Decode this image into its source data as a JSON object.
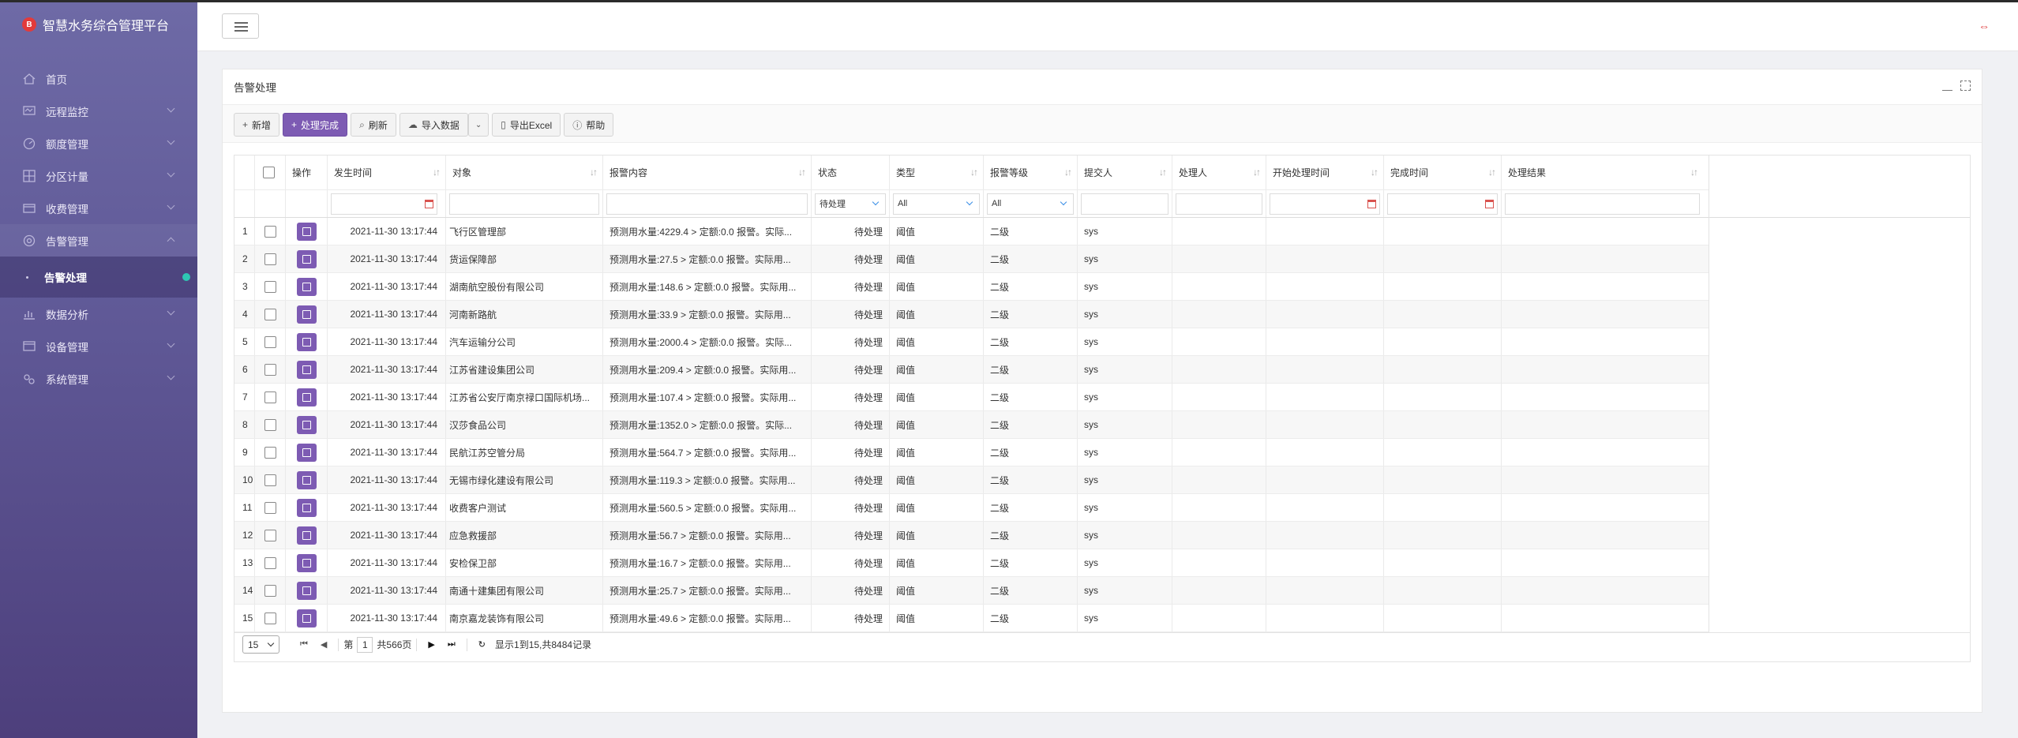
{
  "app": {
    "title": "智慧水务综合管理平台"
  },
  "sidebar": {
    "items": [
      {
        "label": "首页",
        "icon": "home-icon"
      },
      {
        "label": "远程监控",
        "icon": "monitor-icon"
      },
      {
        "label": "额度管理",
        "icon": "quota-icon"
      },
      {
        "label": "分区计量",
        "icon": "grid-icon"
      },
      {
        "label": "收费管理",
        "icon": "billing-icon"
      },
      {
        "label": "告警管理",
        "icon": "alarm-icon"
      },
      {
        "label": "数据分析",
        "icon": "analysis-icon"
      },
      {
        "label": "设备管理",
        "icon": "device-icon"
      },
      {
        "label": "系统管理",
        "icon": "settings-icon"
      }
    ],
    "sub_item": "告警处理"
  },
  "panel": {
    "title": "告警处理"
  },
  "toolbar": {
    "add": "新增",
    "complete": "处理完成",
    "refresh": "刷新",
    "import": "导入数据",
    "export": "导出Excel",
    "help": "帮助"
  },
  "table": {
    "columns": {
      "op": "操作",
      "time": "发生时间",
      "object": "对象",
      "content": "报警内容",
      "status": "状态",
      "type": "类型",
      "level": "报警等级",
      "submitter": "提交人",
      "handler": "处理人",
      "start": "开始处理时间",
      "end": "完成时间",
      "result": "处理结果"
    },
    "filters": {
      "status": "待处理",
      "type": "All",
      "level": "All"
    },
    "rows": [
      {
        "idx": "1",
        "time": "2021-11-30 13:17:44",
        "object": "飞行区管理部",
        "content": "预测用水量:4229.4 > 定额:0.0 报警。实际...",
        "status": "待处理",
        "type": "阈值",
        "level": "二级",
        "submitter": "sys"
      },
      {
        "idx": "2",
        "time": "2021-11-30 13:17:44",
        "object": "货运保障部",
        "content": "预测用水量:27.5 > 定额:0.0 报警。实际用...",
        "status": "待处理",
        "type": "阈值",
        "level": "二级",
        "submitter": "sys"
      },
      {
        "idx": "3",
        "time": "2021-11-30 13:17:44",
        "object": "湖南航空股份有限公司",
        "content": "预测用水量:148.6 > 定额:0.0 报警。实际用...",
        "status": "待处理",
        "type": "阈值",
        "level": "二级",
        "submitter": "sys"
      },
      {
        "idx": "4",
        "time": "2021-11-30 13:17:44",
        "object": "河南新路航",
        "content": "预测用水量:33.9 > 定额:0.0 报警。实际用...",
        "status": "待处理",
        "type": "阈值",
        "level": "二级",
        "submitter": "sys"
      },
      {
        "idx": "5",
        "time": "2021-11-30 13:17:44",
        "object": "汽车运输分公司",
        "content": "预测用水量:2000.4 > 定额:0.0 报警。实际...",
        "status": "待处理",
        "type": "阈值",
        "level": "二级",
        "submitter": "sys"
      },
      {
        "idx": "6",
        "time": "2021-11-30 13:17:44",
        "object": "江苏省建设集团公司",
        "content": "预测用水量:209.4 > 定额:0.0 报警。实际用...",
        "status": "待处理",
        "type": "阈值",
        "level": "二级",
        "submitter": "sys"
      },
      {
        "idx": "7",
        "time": "2021-11-30 13:17:44",
        "object": "江苏省公安厅南京禄口国际机场...",
        "content": "预测用水量:107.4 > 定额:0.0 报警。实际用...",
        "status": "待处理",
        "type": "阈值",
        "level": "二级",
        "submitter": "sys"
      },
      {
        "idx": "8",
        "time": "2021-11-30 13:17:44",
        "object": "汉莎食品公司",
        "content": "预测用水量:1352.0 > 定额:0.0 报警。实际...",
        "status": "待处理",
        "type": "阈值",
        "level": "二级",
        "submitter": "sys"
      },
      {
        "idx": "9",
        "time": "2021-11-30 13:17:44",
        "object": "民航江苏空管分局",
        "content": "预测用水量:564.7 > 定额:0.0 报警。实际用...",
        "status": "待处理",
        "type": "阈值",
        "level": "二级",
        "submitter": "sys"
      },
      {
        "idx": "10",
        "time": "2021-11-30 13:17:44",
        "object": "无锡市绿化建设有限公司",
        "content": "预测用水量:119.3 > 定额:0.0 报警。实际用...",
        "status": "待处理",
        "type": "阈值",
        "level": "二级",
        "submitter": "sys"
      },
      {
        "idx": "11",
        "time": "2021-11-30 13:17:44",
        "object": "收费客户测试",
        "content": "预测用水量:560.5 > 定额:0.0 报警。实际用...",
        "status": "待处理",
        "type": "阈值",
        "level": "二级",
        "submitter": "sys"
      },
      {
        "idx": "12",
        "time": "2021-11-30 13:17:44",
        "object": "应急救援部",
        "content": "预测用水量:56.7 > 定额:0.0 报警。实际用...",
        "status": "待处理",
        "type": "阈值",
        "level": "二级",
        "submitter": "sys"
      },
      {
        "idx": "13",
        "time": "2021-11-30 13:17:44",
        "object": "安检保卫部",
        "content": "预测用水量:16.7 > 定额:0.0 报警。实际用...",
        "status": "待处理",
        "type": "阈值",
        "level": "二级",
        "submitter": "sys"
      },
      {
        "idx": "14",
        "time": "2021-11-30 13:17:44",
        "object": "南通十建集团有限公司",
        "content": "预测用水量:25.7 > 定额:0.0 报警。实际用...",
        "status": "待处理",
        "type": "阈值",
        "level": "二级",
        "submitter": "sys"
      },
      {
        "idx": "15",
        "time": "2021-11-30 13:17:44",
        "object": "南京嘉龙装饰有限公司",
        "content": "预测用水量:49.6 > 定额:0.0 报警。实际用...",
        "status": "待处理",
        "type": "阈值",
        "level": "二级",
        "submitter": "sys"
      }
    ]
  },
  "pager": {
    "page_size": "15",
    "page_prefix": "第",
    "current_page": "1",
    "total_pages": "共566页",
    "summary": "显示1到15,共8484记录"
  },
  "colors": {
    "accent": "#7d5bb3",
    "sidebar_top": "#6e6aa6",
    "sidebar_bottom": "#4d3f7c",
    "badge": "#2ec7b3"
  }
}
